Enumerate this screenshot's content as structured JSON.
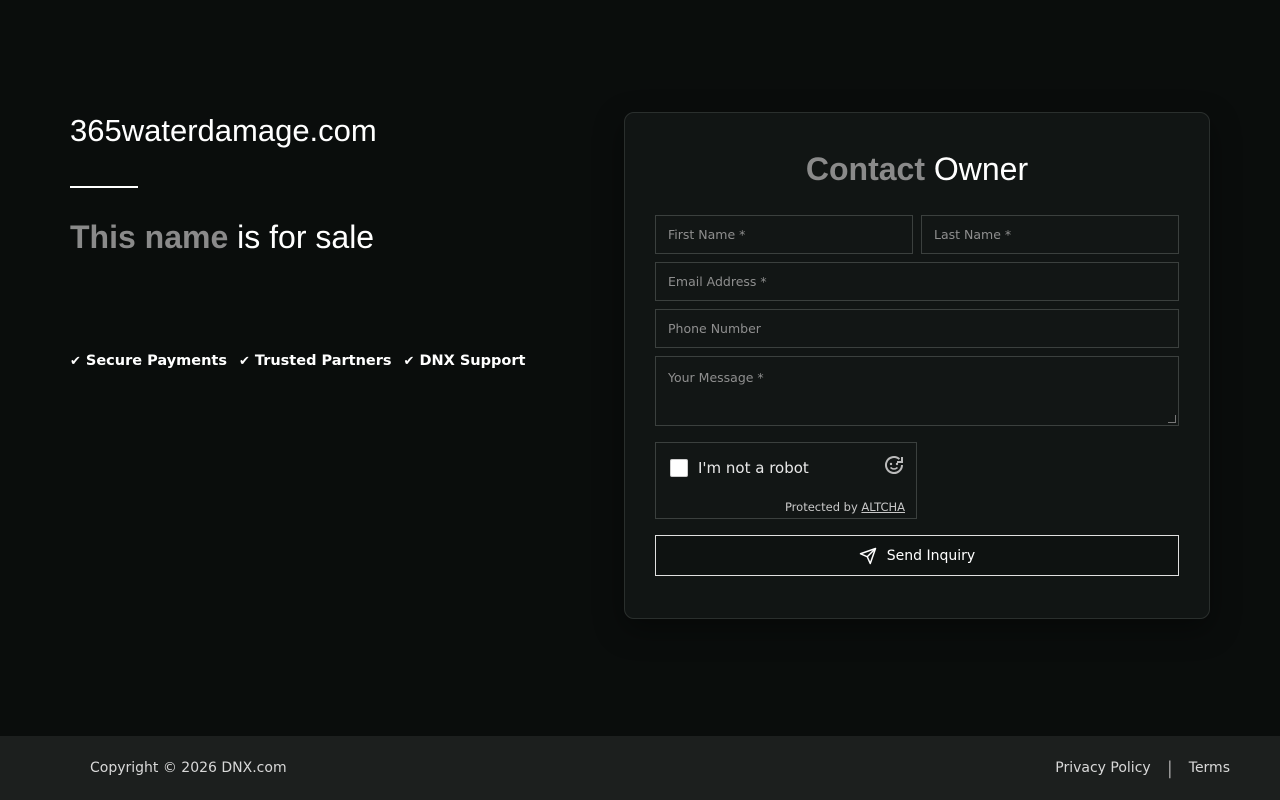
{
  "hero": {
    "domain": "365waterdamage.com",
    "sale_prefix": "This name",
    "sale_suffix": " is for sale",
    "features": [
      "Secure Payments",
      "Trusted Partners",
      "DNX Support"
    ]
  },
  "contact": {
    "title_prefix": "Contact",
    "title_suffix": " Owner",
    "first_name_placeholder": "First Name *",
    "last_name_placeholder": "Last Name *",
    "email_placeholder": "Email Address *",
    "phone_placeholder": "Phone Number",
    "message_placeholder": "Your Message *",
    "captcha_label": "I'm not a robot",
    "captcha_protected": "Protected by",
    "captcha_provider": "ALTCHA",
    "submit_label": "Send Inquiry"
  },
  "footer": {
    "copyright": "Copyright © 2026 DNX.com",
    "privacy": "Privacy Policy",
    "separator": "|",
    "terms": "Terms"
  },
  "icons": {
    "check": "check-icon",
    "captcha": "altcha-logo-icon",
    "send": "paper-plane-icon"
  },
  "colors": {
    "background": "#0a0d0c",
    "card": "#111514",
    "footer": "#1c1f1e",
    "muted_text": "#8a8a8a"
  }
}
